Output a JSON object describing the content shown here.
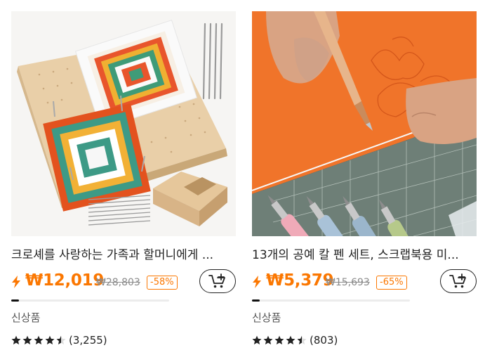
{
  "products": [
    {
      "title": "크로셰를 사랑하는 가족과 할머니에게 ...",
      "price": "₩12,019",
      "original_price": "₩28,803",
      "discount": "-58%",
      "badge": "신상품",
      "stars": 4.5,
      "review_count": "(3,255)",
      "sales_progress": 0.05,
      "image_icon": "crochet-blocking-board-image",
      "flash_icon": "lightning-icon",
      "cart_icon": "add-to-cart-icon"
    },
    {
      "title": "13개의 공예 칼 펜 세트, 스크랩북용 미...",
      "price": "₩5,379",
      "original_price": "₩15,693",
      "discount": "-65%",
      "badge": "신상품",
      "stars": 4.5,
      "review_count": "(803)",
      "sales_progress": 0.05,
      "image_icon": "craft-knife-pen-set-image",
      "flash_icon": "lightning-icon",
      "cart_icon": "add-to-cart-icon"
    }
  ],
  "colors": {
    "accent": "#fb7701",
    "muted": "#8a8a8a",
    "text": "#222222"
  }
}
